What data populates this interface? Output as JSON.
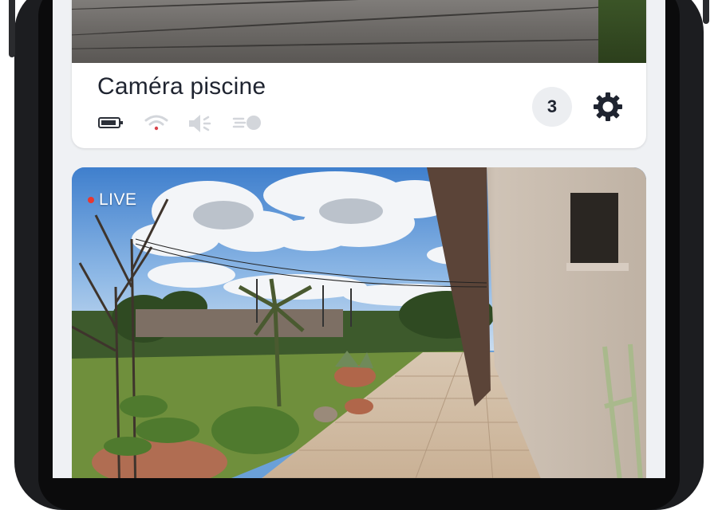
{
  "camera": {
    "name": "Caméra piscine",
    "event_count": "3"
  },
  "status_icons": [
    "battery-icon",
    "wifi-icon",
    "speaker-muted-icon",
    "motion-sensor-icon"
  ],
  "live_feed": {
    "label": "LIVE"
  },
  "colors": {
    "screen_background": "#eff1f4",
    "card_background": "#ffffff",
    "title_text": "#1f2430",
    "badge_background": "#eceef1",
    "status_icon_gray": "#c8ccd2",
    "wifi_dot": "#d9434b",
    "live_dot": "#e8372f"
  }
}
